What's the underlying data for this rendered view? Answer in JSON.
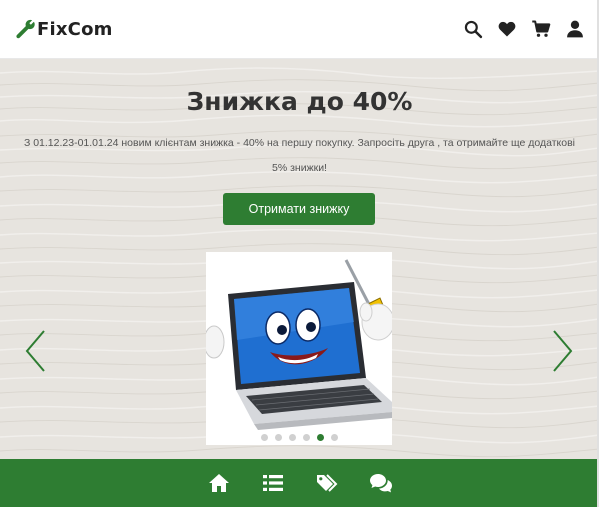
{
  "header": {
    "brand_name": "FixCom",
    "logo_icon": "wrench-icon",
    "icons": [
      "search-icon",
      "heart-icon",
      "cart-icon",
      "user-icon"
    ]
  },
  "hero": {
    "title": "Знижка до 40%",
    "description": "З 01.12.23-01.01.24 новим клієнтам знижка - 40% на першу покупку. Запросіть друга , та отримайте ще додаткові 5% знижки!",
    "cta_label": "Отримати знижку"
  },
  "carousel": {
    "slide_image": "cartoon-laptop-with-screwdriver",
    "slide_count": 6,
    "active_index": 4,
    "prev_icon": "chevron-left-icon",
    "next_icon": "chevron-right-icon"
  },
  "bottom_nav": {
    "icons": [
      "home-icon",
      "list-icon",
      "tags-icon",
      "chat-icon"
    ]
  },
  "colors": {
    "accent": "#2e7d32",
    "hero_bg": "#e6e3de",
    "text_dark": "#333333"
  }
}
